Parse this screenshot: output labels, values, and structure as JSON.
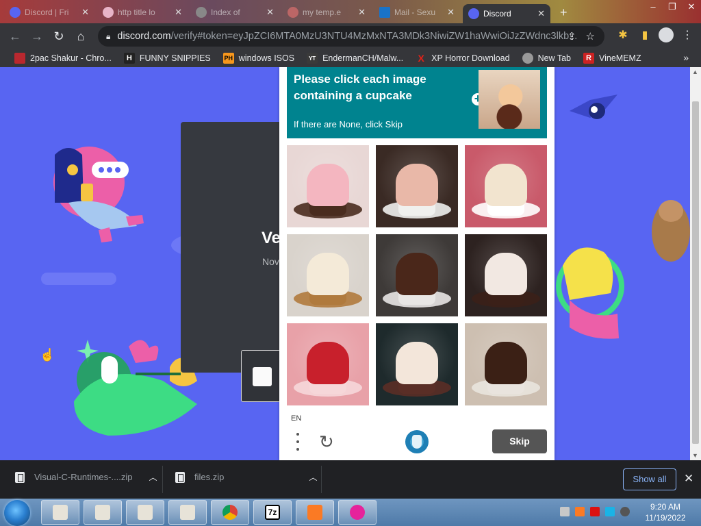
{
  "browser": {
    "tabs": [
      {
        "title": "Discord | Fri",
        "active": false
      },
      {
        "title": "http title lo",
        "active": false
      },
      {
        "title": "Index of",
        "active": false
      },
      {
        "title": "my temp.e",
        "active": false
      },
      {
        "title": "Mail - Sexu",
        "active": false
      },
      {
        "title": "Discord",
        "active": true
      }
    ],
    "url": {
      "host": "discord.com",
      "path": "/verify#token=eyJpZCI6MTA0MzU3NTU4MzMxNTA3MDk3NiwiZW1haWwiOiJzZWdnc3lkb..."
    },
    "bookmarks": [
      {
        "label": "2pac Shakur - Chro...",
        "color": "#b9282f",
        "glyph": ""
      },
      {
        "label": "FUNNY SNIPPIES",
        "color": "#222222",
        "glyph": "H"
      },
      {
        "label": "windows ISOS",
        "color": "#f7971d",
        "glyph": "PH"
      },
      {
        "label": "EndermanCH/Malw...",
        "color": "#c4302b",
        "glyph": "YT"
      },
      {
        "label": "XP Horror Download",
        "color": "#e62117",
        "glyph": "X"
      },
      {
        "label": "New Tab",
        "color": "#999999",
        "glyph": ""
      },
      {
        "label": "VineMEMZ",
        "color": "#cc2222",
        "glyph": "R"
      }
    ]
  },
  "discord": {
    "heading": "Ve",
    "subtext": "Nov"
  },
  "captcha": {
    "prompt": "Please click each image containing a cupcake",
    "note": "If there are None, click Skip",
    "language": "EN",
    "skip_label": "Skip",
    "images": [
      {
        "subject": "cupcake-pink-frosting",
        "bg": "#e8d7d5",
        "food": "#f4b6c0",
        "base": "#4a2c1f"
      },
      {
        "subject": "strawberry-ice-cream",
        "bg": "#3a2a24",
        "food": "#e9b8a8",
        "base": "#f0f0ee"
      },
      {
        "subject": "strawberry-shortcake",
        "bg": "#c95a6a",
        "food": "#f2e4cf",
        "base": "#ffffff"
      },
      {
        "subject": "cupcake-vanilla-frosting",
        "bg": "#d9d3cc",
        "food": "#f4ead8",
        "base": "#b07a3d"
      },
      {
        "subject": "chocolate-cake-slice",
        "bg": "#3e3a38",
        "food": "#4a271a",
        "base": "#e8e6e4"
      },
      {
        "subject": "chocolate-cupcake-plate",
        "bg": "#2d2220",
        "food": "#f2e8e2",
        "base": "#3b2018"
      },
      {
        "subject": "strawberry-cheesecake",
        "bg": "#e8a1a8",
        "food": "#c8202c",
        "base": "#f6d7d9"
      },
      {
        "subject": "cupcake-chocolate-base",
        "bg": "#1e2a2c",
        "food": "#f3e6da",
        "base": "#5a2e26"
      },
      {
        "subject": "chocolate-mousse-cup",
        "bg": "#cdbfb1",
        "food": "#3b2015",
        "base": "#e9e4de"
      }
    ]
  },
  "downloads": [
    {
      "name": "Visual-C-Runtimes-....zip"
    },
    {
      "name": "files.zip"
    }
  ],
  "download_bar": {
    "show_all": "Show all"
  },
  "taskbar": {
    "apps": [
      "explorer-1",
      "explorer-2",
      "explorer-3",
      "explorer-4",
      "chrome",
      "7zip",
      "xampp",
      "wamp"
    ],
    "time": "9:20 AM",
    "date": "11/19/2022"
  }
}
